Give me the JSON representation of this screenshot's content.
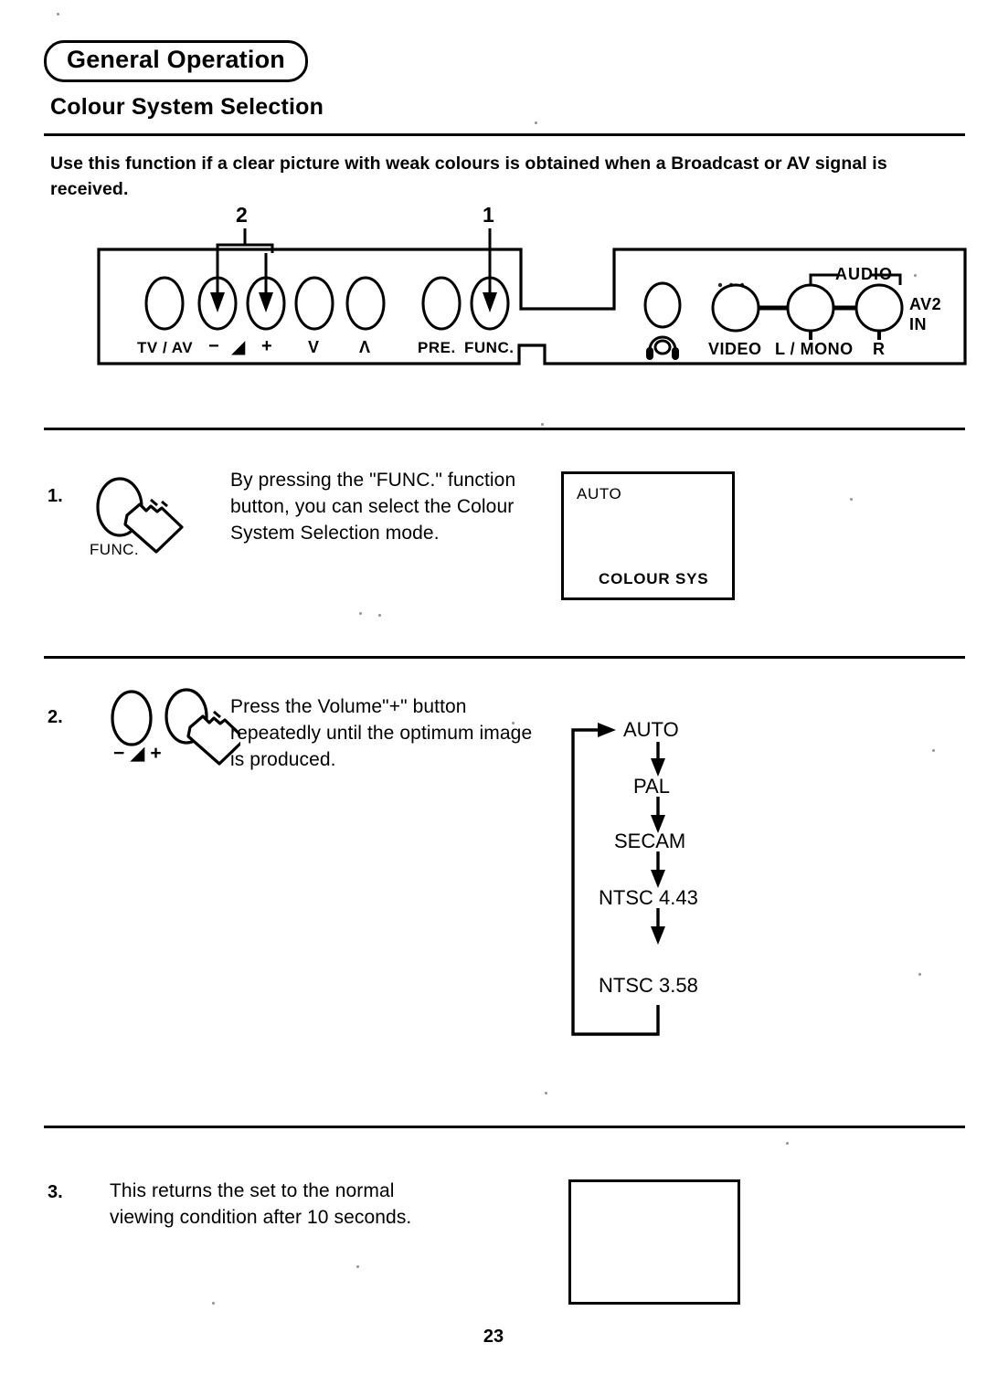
{
  "header": {
    "badge": "General Operation",
    "section_title": "Colour System Selection"
  },
  "intro": "Use this function if a clear picture with weak colours is obtained when a Broadcast or AV signal is received.",
  "panel": {
    "callouts": [
      {
        "label": "2",
        "target": "volume-minus-plus-buttons"
      },
      {
        "label": "1",
        "target": "func-button"
      }
    ],
    "buttons": [
      {
        "label": "TV / AV",
        "name": "tv-av-button"
      },
      {
        "label": "−",
        "name": "volume-down-button"
      },
      {
        "label": "◢",
        "name": "volume-icon"
      },
      {
        "label": "+",
        "name": "volume-up-button"
      },
      {
        "label": "V",
        "name": "channel-down-button"
      },
      {
        "label": "Λ",
        "name": "channel-up-button"
      },
      {
        "label": "PRE.",
        "name": "pre-button"
      },
      {
        "label": "FUNC.",
        "name": "func-button"
      }
    ],
    "jacks": {
      "headphone": "headphone-jack",
      "audio_bracket": "AUDIO",
      "av2_in": "AV2\nIN",
      "av2_in_line1": "AV2",
      "av2_in_line2": "IN",
      "items": [
        {
          "label": "VIDEO",
          "name": "video-jack"
        },
        {
          "label": "L / MONO",
          "name": "audio-left-mono-jack"
        },
        {
          "label": "R",
          "name": "audio-right-jack"
        }
      ]
    }
  },
  "steps": [
    {
      "number": "1.",
      "icon_label": "FUNC.",
      "text": "By pressing the \"FUNC.\" function button, you can select the Colour System Selection mode.",
      "screen": {
        "top_left": "AUTO",
        "bottom_left": "COLOUR SYS"
      }
    },
    {
      "number": "2.",
      "icon_labels": {
        "minus": "−",
        "volume": "◢",
        "plus": "+"
      },
      "text": "Press the Volume\"+\" button repeatedly until the optimum image is produced.",
      "flow": {
        "nodes": [
          "AUTO",
          "PAL",
          "SECAM",
          "NTSC 4.43",
          "NTSC 3.58"
        ],
        "loops_back_to": "AUTO"
      }
    },
    {
      "number": "3.",
      "text": "This returns the set to the normal viewing condition after 10 seconds.",
      "screen": {
        "top_left": "",
        "bottom_left": ""
      }
    }
  ],
  "page_number": "23",
  "colors": {
    "ink": "#000000",
    "paper": "#ffffff"
  }
}
